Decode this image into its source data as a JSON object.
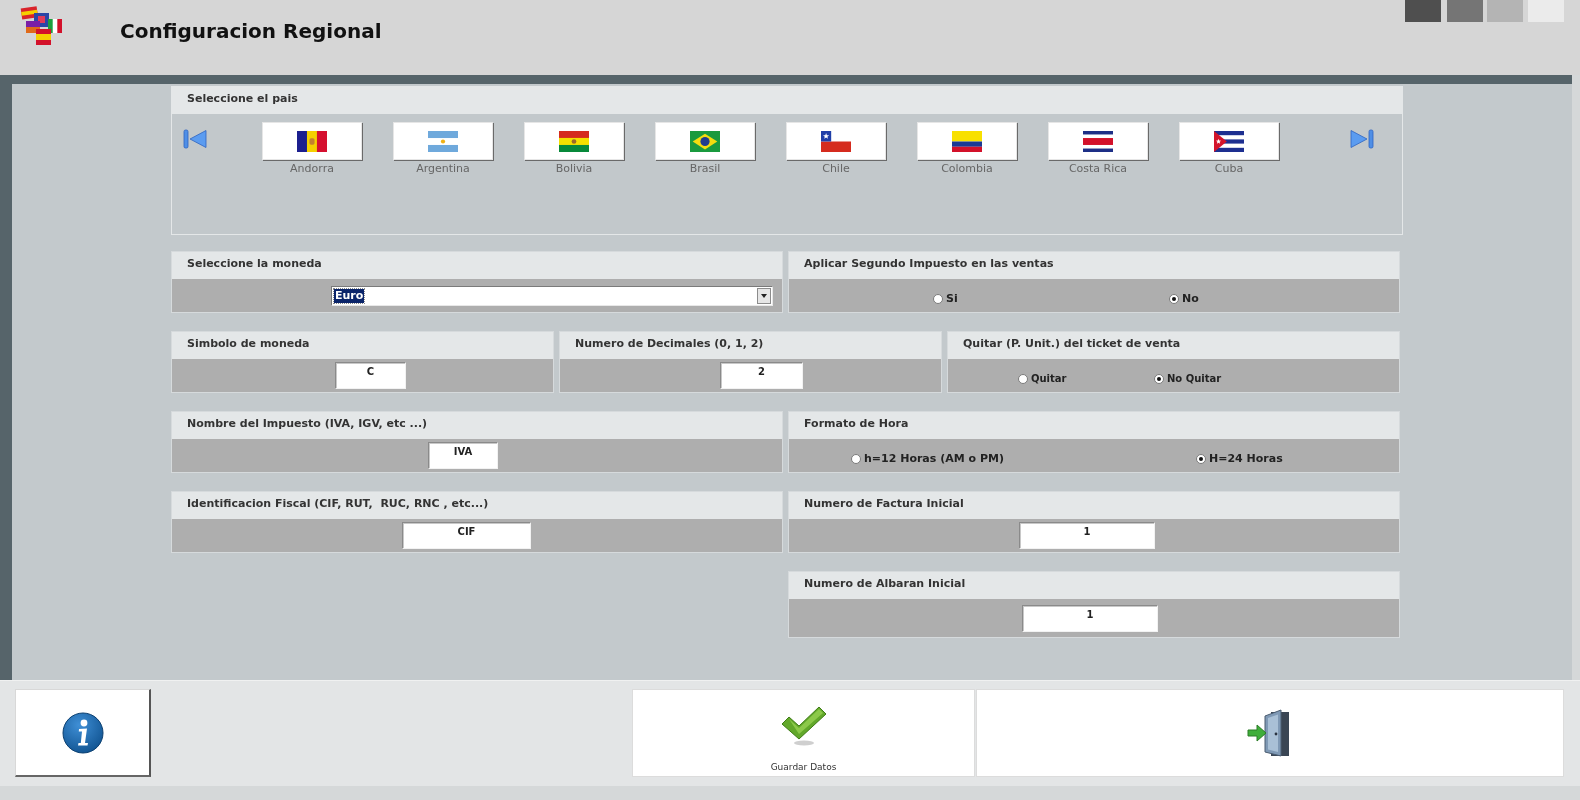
{
  "header": {
    "title": "Configuracion Regional"
  },
  "country_picker": {
    "label": "Seleccione el pais",
    "countries": [
      {
        "name": "Andorra",
        "kind": "andorra"
      },
      {
        "name": "Argentina",
        "kind": "argentina"
      },
      {
        "name": "Bolivia",
        "kind": "bolivia"
      },
      {
        "name": "Brasil",
        "kind": "brasil"
      },
      {
        "name": "Chile",
        "kind": "chile"
      },
      {
        "name": "Colombia",
        "kind": "colombia"
      },
      {
        "name": "Costa Rica",
        "kind": "costa_rica"
      },
      {
        "name": "Cuba",
        "kind": "cuba"
      }
    ]
  },
  "form": {
    "currency": {
      "kind": "select",
      "label": "Seleccione la moneda",
      "value": "Euro",
      "text_selected": true
    },
    "second_tax": {
      "kind": "radio",
      "label": "Aplicar Segundo Impuesto en las ventas",
      "options": [
        {
          "label": "Si",
          "selected": false
        },
        {
          "label": "No",
          "selected": true
        }
      ]
    },
    "currency_symbol": {
      "kind": "text",
      "label": "Simbolo de moneda",
      "value": "C"
    },
    "decimals": {
      "kind": "text",
      "label": "Numero de Decimales (0, 1, 2)",
      "value": "2"
    },
    "unit_price_ticket": {
      "kind": "radio",
      "label": "Quitar (P. Unit.) del ticket de venta",
      "options": [
        {
          "label": "Quitar",
          "selected": false
        },
        {
          "label": "No Quitar",
          "selected": true
        }
      ]
    },
    "tax_name": {
      "kind": "text",
      "label": "Nombre del Impuesto (IVA, IGV, etc ...)",
      "value": "IVA"
    },
    "time_format": {
      "kind": "radio",
      "label": "Formato de Hora",
      "options": [
        {
          "label": "h=12 Horas (AM o PM)",
          "selected": false
        },
        {
          "label": "H=24 Horas",
          "selected": true
        }
      ]
    },
    "fiscal_id": {
      "kind": "text",
      "label": "Identificacion Fiscal (CIF, RUT,  RUC, RNC , etc...)",
      "value": "CIF"
    },
    "invoice_start": {
      "kind": "text",
      "label": "Numero de Factura Inicial",
      "value": "1"
    },
    "delivery_note_start": {
      "kind": "text",
      "label": "Numero de Albaran Inicial",
      "value": "1"
    }
  },
  "footer": {
    "buttons": [
      {
        "kind": "info"
      },
      {
        "kind": "save",
        "label": "Guardar Datos"
      },
      {
        "kind": "exit"
      }
    ]
  }
}
